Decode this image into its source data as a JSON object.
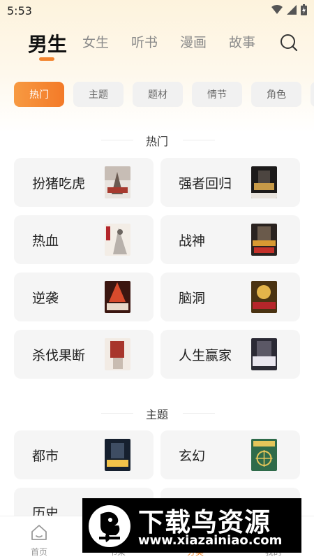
{
  "status_bar": {
    "time": "5:53"
  },
  "top_tabs": [
    {
      "label": "男生",
      "active": true
    },
    {
      "label": "女生",
      "active": false
    },
    {
      "label": "听书",
      "active": false
    },
    {
      "label": "漫画",
      "active": false
    },
    {
      "label": "故事",
      "active": false
    }
  ],
  "chips": [
    {
      "label": "热门",
      "active": true
    },
    {
      "label": "主题",
      "active": false
    },
    {
      "label": "题材",
      "active": false
    },
    {
      "label": "情节",
      "active": false
    },
    {
      "label": "角色",
      "active": false
    }
  ],
  "sections": [
    {
      "title": "热门",
      "items": [
        {
          "label": "扮猪吃虎",
          "cover_colors": [
            "#e9e4df",
            "#a73a2f"
          ]
        },
        {
          "label": "强者回归",
          "cover_colors": [
            "#1c1a1a",
            "#c79a48"
          ]
        },
        {
          "label": "热血",
          "cover_colors": [
            "#f3ede6",
            "#b3262b"
          ]
        },
        {
          "label": "战神",
          "cover_colors": [
            "#2a2320",
            "#d99a32"
          ]
        },
        {
          "label": "逆袭",
          "cover_colors": [
            "#3b1610",
            "#d74b2c"
          ]
        },
        {
          "label": "脑洞",
          "cover_colors": [
            "#4a3312",
            "#e3b44a"
          ]
        },
        {
          "label": "杀伐果断",
          "cover_colors": [
            "#f2ebe4",
            "#a8362c"
          ]
        },
        {
          "label": "人生赢家",
          "cover_colors": [
            "#2b2a35",
            "#e9e6ef"
          ]
        }
      ]
    },
    {
      "title": "主题",
      "items": [
        {
          "label": "都市",
          "cover_colors": [
            "#16202f",
            "#f3c34a"
          ]
        },
        {
          "label": "玄幻",
          "cover_colors": [
            "#2f6b4a",
            "#e4c55a"
          ]
        },
        {
          "label": "历史",
          "cover_colors": [
            "#ffffff",
            "#ffffff"
          ]
        },
        {
          "label": "",
          "cover_colors": [
            "#ffffff",
            "#ffffff"
          ]
        }
      ]
    }
  ],
  "bottom_nav": [
    {
      "label": "首页",
      "icon": "home-icon",
      "active": false
    },
    {
      "label": "书架",
      "icon": "bookshelf-icon",
      "active": false
    },
    {
      "label": "分类",
      "icon": "category-icon",
      "active": true
    },
    {
      "label": "我的",
      "icon": "profile-icon",
      "active": false
    }
  ],
  "watermark": {
    "title": "下载鸟资源",
    "url": "www.xiazainiao.com"
  },
  "colors": {
    "accent": "#f37a28",
    "card_bg": "#f5f5f5",
    "chip_bg": "#f1f1f1"
  }
}
